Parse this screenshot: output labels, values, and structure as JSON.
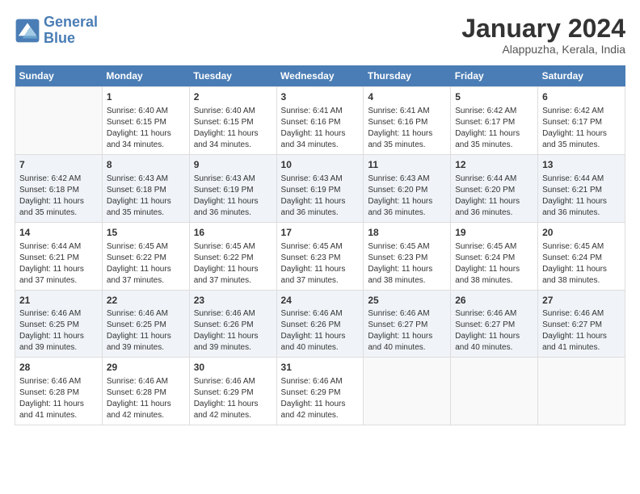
{
  "header": {
    "logo_line1": "General",
    "logo_line2": "Blue",
    "title": "January 2024",
    "subtitle": "Alappuzha, Kerala, India"
  },
  "days_of_week": [
    "Sunday",
    "Monday",
    "Tuesday",
    "Wednesday",
    "Thursday",
    "Friday",
    "Saturday"
  ],
  "weeks": [
    [
      {
        "day": "",
        "info": ""
      },
      {
        "day": "1",
        "info": "Sunrise: 6:40 AM\nSunset: 6:15 PM\nDaylight: 11 hours\nand 34 minutes."
      },
      {
        "day": "2",
        "info": "Sunrise: 6:40 AM\nSunset: 6:15 PM\nDaylight: 11 hours\nand 34 minutes."
      },
      {
        "day": "3",
        "info": "Sunrise: 6:41 AM\nSunset: 6:16 PM\nDaylight: 11 hours\nand 34 minutes."
      },
      {
        "day": "4",
        "info": "Sunrise: 6:41 AM\nSunset: 6:16 PM\nDaylight: 11 hours\nand 35 minutes."
      },
      {
        "day": "5",
        "info": "Sunrise: 6:42 AM\nSunset: 6:17 PM\nDaylight: 11 hours\nand 35 minutes."
      },
      {
        "day": "6",
        "info": "Sunrise: 6:42 AM\nSunset: 6:17 PM\nDaylight: 11 hours\nand 35 minutes."
      }
    ],
    [
      {
        "day": "7",
        "info": "Sunrise: 6:42 AM\nSunset: 6:18 PM\nDaylight: 11 hours\nand 35 minutes."
      },
      {
        "day": "8",
        "info": "Sunrise: 6:43 AM\nSunset: 6:18 PM\nDaylight: 11 hours\nand 35 minutes."
      },
      {
        "day": "9",
        "info": "Sunrise: 6:43 AM\nSunset: 6:19 PM\nDaylight: 11 hours\nand 36 minutes."
      },
      {
        "day": "10",
        "info": "Sunrise: 6:43 AM\nSunset: 6:19 PM\nDaylight: 11 hours\nand 36 minutes."
      },
      {
        "day": "11",
        "info": "Sunrise: 6:43 AM\nSunset: 6:20 PM\nDaylight: 11 hours\nand 36 minutes."
      },
      {
        "day": "12",
        "info": "Sunrise: 6:44 AM\nSunset: 6:20 PM\nDaylight: 11 hours\nand 36 minutes."
      },
      {
        "day": "13",
        "info": "Sunrise: 6:44 AM\nSunset: 6:21 PM\nDaylight: 11 hours\nand 36 minutes."
      }
    ],
    [
      {
        "day": "14",
        "info": "Sunrise: 6:44 AM\nSunset: 6:21 PM\nDaylight: 11 hours\nand 37 minutes."
      },
      {
        "day": "15",
        "info": "Sunrise: 6:45 AM\nSunset: 6:22 PM\nDaylight: 11 hours\nand 37 minutes."
      },
      {
        "day": "16",
        "info": "Sunrise: 6:45 AM\nSunset: 6:22 PM\nDaylight: 11 hours\nand 37 minutes."
      },
      {
        "day": "17",
        "info": "Sunrise: 6:45 AM\nSunset: 6:23 PM\nDaylight: 11 hours\nand 37 minutes."
      },
      {
        "day": "18",
        "info": "Sunrise: 6:45 AM\nSunset: 6:23 PM\nDaylight: 11 hours\nand 38 minutes."
      },
      {
        "day": "19",
        "info": "Sunrise: 6:45 AM\nSunset: 6:24 PM\nDaylight: 11 hours\nand 38 minutes."
      },
      {
        "day": "20",
        "info": "Sunrise: 6:45 AM\nSunset: 6:24 PM\nDaylight: 11 hours\nand 38 minutes."
      }
    ],
    [
      {
        "day": "21",
        "info": "Sunrise: 6:46 AM\nSunset: 6:25 PM\nDaylight: 11 hours\nand 39 minutes."
      },
      {
        "day": "22",
        "info": "Sunrise: 6:46 AM\nSunset: 6:25 PM\nDaylight: 11 hours\nand 39 minutes."
      },
      {
        "day": "23",
        "info": "Sunrise: 6:46 AM\nSunset: 6:26 PM\nDaylight: 11 hours\nand 39 minutes."
      },
      {
        "day": "24",
        "info": "Sunrise: 6:46 AM\nSunset: 6:26 PM\nDaylight: 11 hours\nand 40 minutes."
      },
      {
        "day": "25",
        "info": "Sunrise: 6:46 AM\nSunset: 6:27 PM\nDaylight: 11 hours\nand 40 minutes."
      },
      {
        "day": "26",
        "info": "Sunrise: 6:46 AM\nSunset: 6:27 PM\nDaylight: 11 hours\nand 40 minutes."
      },
      {
        "day": "27",
        "info": "Sunrise: 6:46 AM\nSunset: 6:27 PM\nDaylight: 11 hours\nand 41 minutes."
      }
    ],
    [
      {
        "day": "28",
        "info": "Sunrise: 6:46 AM\nSunset: 6:28 PM\nDaylight: 11 hours\nand 41 minutes."
      },
      {
        "day": "29",
        "info": "Sunrise: 6:46 AM\nSunset: 6:28 PM\nDaylight: 11 hours\nand 42 minutes."
      },
      {
        "day": "30",
        "info": "Sunrise: 6:46 AM\nSunset: 6:29 PM\nDaylight: 11 hours\nand 42 minutes."
      },
      {
        "day": "31",
        "info": "Sunrise: 6:46 AM\nSunset: 6:29 PM\nDaylight: 11 hours\nand 42 minutes."
      },
      {
        "day": "",
        "info": ""
      },
      {
        "day": "",
        "info": ""
      },
      {
        "day": "",
        "info": ""
      }
    ]
  ]
}
